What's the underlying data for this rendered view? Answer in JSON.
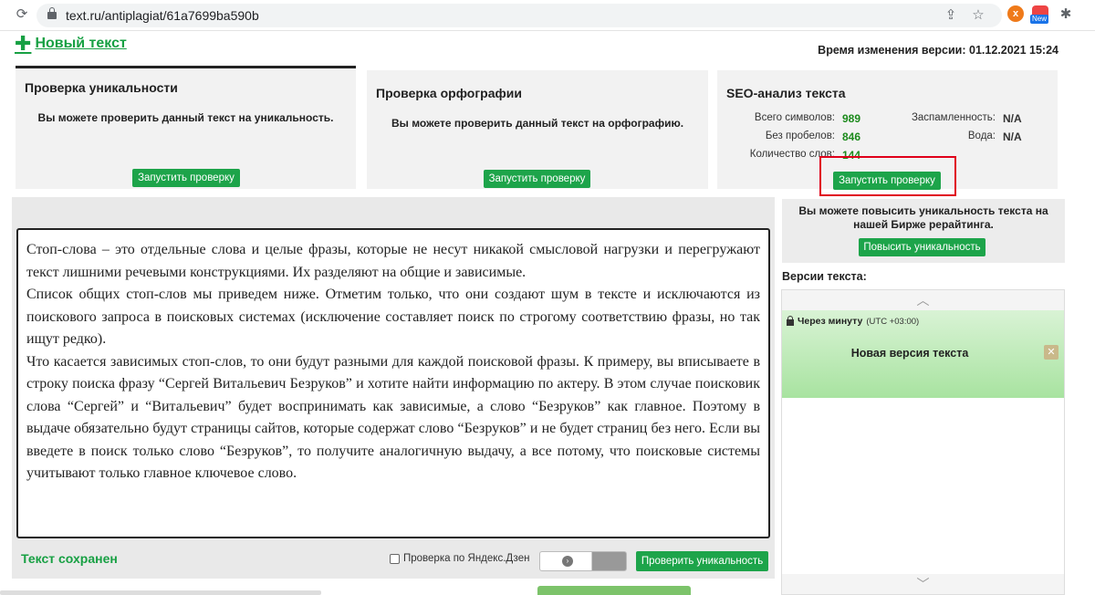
{
  "browser": {
    "url": "text.ru/antiplagiat/61a7699ba590b",
    "ext_new_badge": "New"
  },
  "header": {
    "new_text_label": "Новый текст",
    "version_time": "Время изменения версии: 01.12.2021 15:24"
  },
  "panels": {
    "uniqueness": {
      "title": "Проверка уникальности",
      "message": "Вы можете проверить данный текст на уникальность.",
      "button": "Запустить проверку"
    },
    "spelling": {
      "title": "Проверка орфографии",
      "message": "Вы можете проверить данный текст на орфографию.",
      "button": "Запустить проверку"
    },
    "seo": {
      "title": "SEO-анализ текста",
      "total_chars_label": "Всего символов:",
      "total_chars": "989",
      "no_spaces_label": "Без пробелов:",
      "no_spaces": "846",
      "words_label": "Количество слов:",
      "words": "144",
      "spam_label": "Заспамленность:",
      "spam": "N/A",
      "water_label": "Вода:",
      "water": "N/A",
      "button": "Запустить проверку"
    }
  },
  "editor": {
    "paragraphs": [
      "Стоп-слова – это отдельные слова и целые фразы, которые не несут никакой смысловой нагрузки и перегружают текст лишними речевыми конструкциями.  Их разделяют на общие и зависимые.",
      "Список общих стоп-слов мы приведем ниже. Отметим только, что они создают шум в тексте и исключаются из поискового запроса в поисковых системах (исключение составляет поиск по строгому соответствию фразы, но так ищут редко).",
      "Что касается зависимых стоп-слов, то они будут разными для каждой поисковой фразы. К примеру, вы вписываете в строку поиска фразу “Сергей Витальевич Безруков” и хотите найти информацию по актеру. В этом случае поисковик слова “Сергей” и “Витальевич” будет воспринимать как зависимые, а слово “Безруков” как главное. Поэтому в выдаче обязательно будут страницы сайтов, которые содержат слово “Безруков” и не будет страниц без него. Если вы введете в поиск только слово “Безруков”, то получите аналогичную выдачу, а все потому, что поисковые системы учитывают только главное ключевое слово."
    ],
    "saved_status": "Текст сохранен",
    "yandex_checkbox_label": "Проверка по Яндекс.Дзен",
    "check_button": "Проверить уникальность"
  },
  "sidebar": {
    "promo_text": "Вы можете повысить уникальность текста на нашей Бирже рерайтинга.",
    "promo_button": "Повысить уникальность",
    "versions_title": "Версии текста:",
    "version_item": {
      "time": "Через минуту",
      "utc": "(UTC +03:00)",
      "name": "Новая версия текста",
      "close": "✕"
    }
  },
  "colors": {
    "accent_green": "#1da44a",
    "highlight_red": "#e0001a"
  }
}
